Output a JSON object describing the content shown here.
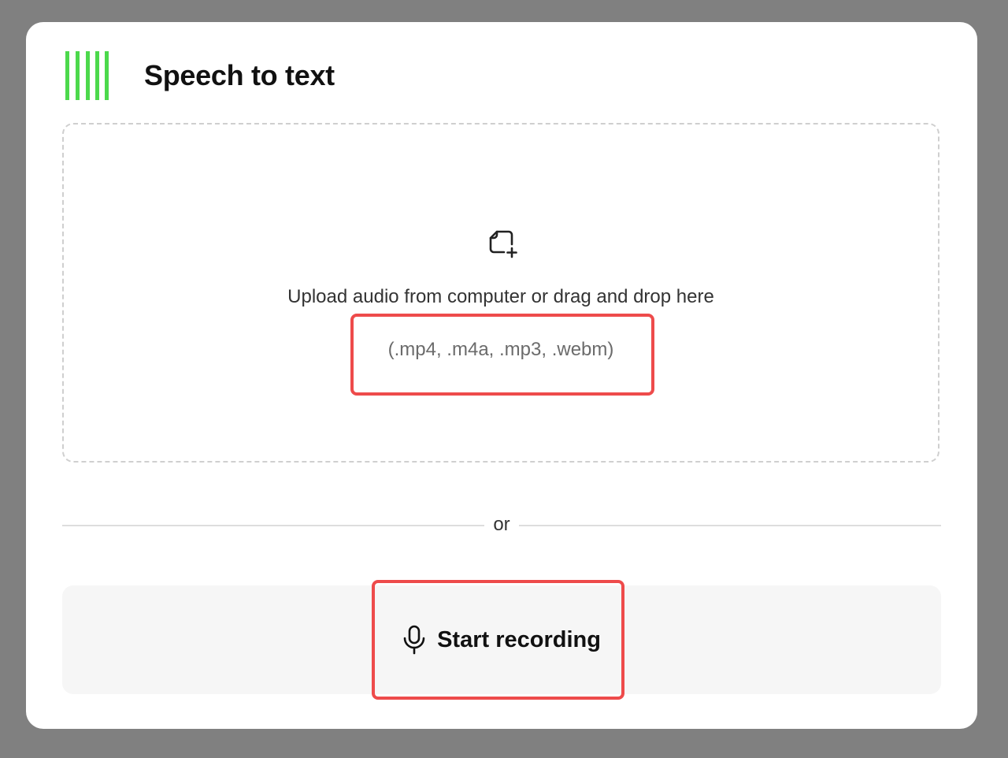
{
  "header": {
    "title": "Speech to text",
    "logo_icon": "audio-bars-logo",
    "logo_color": "#4cd94c"
  },
  "dropzone": {
    "icon": "file-add-icon",
    "instruction": "Upload audio from computer or drag and drop here",
    "formats": "(.mp4, .m4a, .mp3, .webm)"
  },
  "divider": {
    "label": "or"
  },
  "record": {
    "icon": "microphone-icon",
    "label": "Start recording"
  },
  "highlight": {
    "color": "#ee4b4b"
  }
}
